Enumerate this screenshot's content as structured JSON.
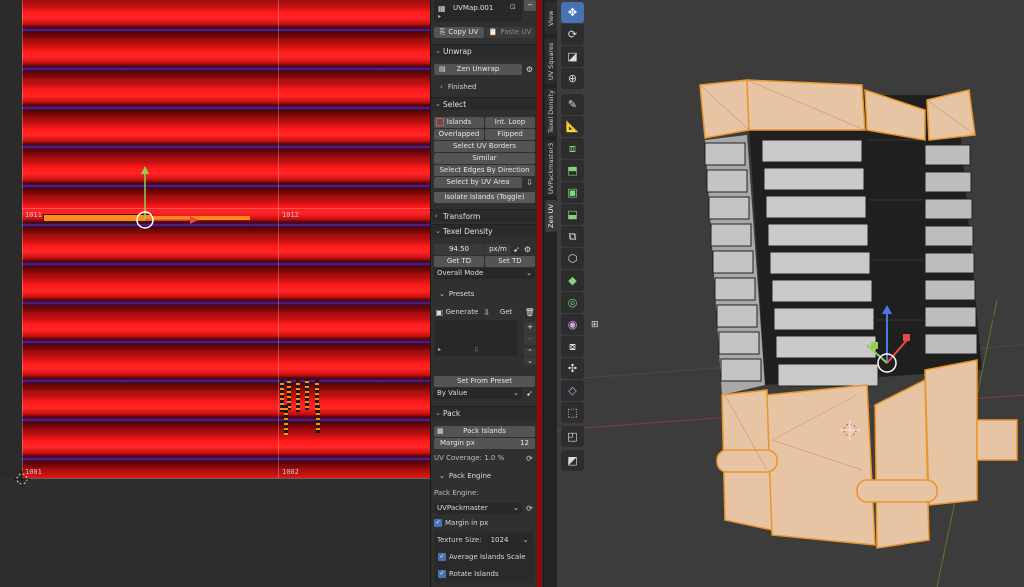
{
  "uv_editor": {
    "tile_labels": [
      "1011",
      "1012",
      "1001",
      "1002"
    ]
  },
  "side_panel": {
    "uvmap": {
      "name": "UVMap.001",
      "copy_uv": "Copy UV",
      "paste_uv": "Paste UV"
    },
    "unwrap": {
      "title": "Unwrap",
      "zen_unwrap": "Zen Unwrap",
      "finished": "Finished"
    },
    "select": {
      "title": "Select",
      "islands": "Islands",
      "int_loop": "Int. Loop",
      "overlapped": "Overlapped",
      "flipped": "Flipped",
      "select_uv_borders": "Select UV Borders",
      "similar": "Similar",
      "select_edges_by_direction": "Select Edges By Direction",
      "select_by_uv_area": "Select by UV Area",
      "isolate_islands": "Isolate Islands (Toggle)"
    },
    "transform": {
      "title": "Transform"
    },
    "texel_density": {
      "title": "Texel Density",
      "value": "94.50",
      "unit": "px/m",
      "get_td": "Get TD",
      "set_td": "Set TD",
      "mode": "Overall Mode",
      "presets": "Presets",
      "generate": "Generate",
      "get": "Get",
      "set_from_preset": "Set From Preset",
      "by_value": "By Value"
    },
    "pack": {
      "title": "Pack",
      "pack_islands": "Pack Islands",
      "margin_label": "Margin px",
      "margin_value": "12",
      "uv_coverage": "UV Coverage: 1.0 %",
      "pack_engine_title": "Pack Engine",
      "pack_engine_label": "Pack Engine:",
      "pack_engine_value": "UVPackmaster",
      "margin_in_px": "Margin in px",
      "texture_size_label": "Texture Size:",
      "texture_size_value": "1024",
      "average_islands_scale": "Average Islands Scale",
      "rotate_islands": "Rotate Islands"
    }
  },
  "vertical_tabs": [
    "View",
    "UV Squares",
    "Texel Density",
    "UVPackmaster3",
    "Zen UV"
  ],
  "viewport": {
    "tools": [
      "move-icon",
      "rotate-icon",
      "scale-icon",
      "transform-icon",
      "annotate-icon",
      "measure-icon",
      "add-cube-icon",
      "extrude-icon",
      "inset-icon",
      "bevel-icon",
      "loop-cut-icon",
      "knife-icon",
      "poly-build-icon",
      "spin-icon",
      "smooth-icon",
      "edge-slide-icon",
      "shrink-fatten-icon",
      "shear-icon",
      "rip-icon"
    ]
  },
  "colors": {
    "accent": "#4772b3",
    "selection_orange": "#e8952a"
  }
}
